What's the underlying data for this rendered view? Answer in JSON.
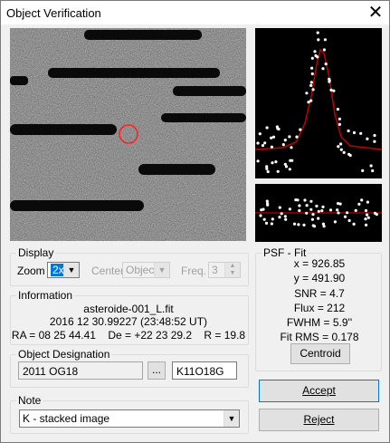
{
  "window": {
    "title": "Object Verification"
  },
  "display": {
    "legend": "Display",
    "zoom_label": "Zoom",
    "zoom_value": "2x",
    "center_label": "Center",
    "center_value": "Object",
    "freq_label": "Freq.",
    "freq_value": "3"
  },
  "information": {
    "legend": "Information",
    "filename": "asteroide-001_L.fit",
    "datetime": "2016 12 30.99227 (23:48:52 UT)",
    "coords": "RA = 08 25 44.41    De = +22 23 29.2    R = 19.8"
  },
  "designation": {
    "legend": "Object Designation",
    "name": "2011 OG18",
    "browse_label": "...",
    "packed": "K11O18G"
  },
  "note": {
    "legend": "Note",
    "value": "K - stacked image"
  },
  "psf": {
    "legend": "PSF - Fit",
    "x": "x = 926.85",
    "y": "y = 491.90",
    "snr": "SNR = 4.7",
    "flux": "Flux = 212",
    "fwhm": "FWHM = 5.9''",
    "rms": "Fit RMS = 0.178",
    "centroid_label": "Centroid"
  },
  "buttons": {
    "accept": "Accept",
    "reject": "Reject"
  },
  "colors": {
    "fit_curve": "#c00000",
    "marker": "#ff2020",
    "selection": "#0078d7"
  },
  "icons": {
    "close": "close-icon",
    "dropdown": "chevron-down-icon",
    "spin": "spin-arrows-icon"
  }
}
